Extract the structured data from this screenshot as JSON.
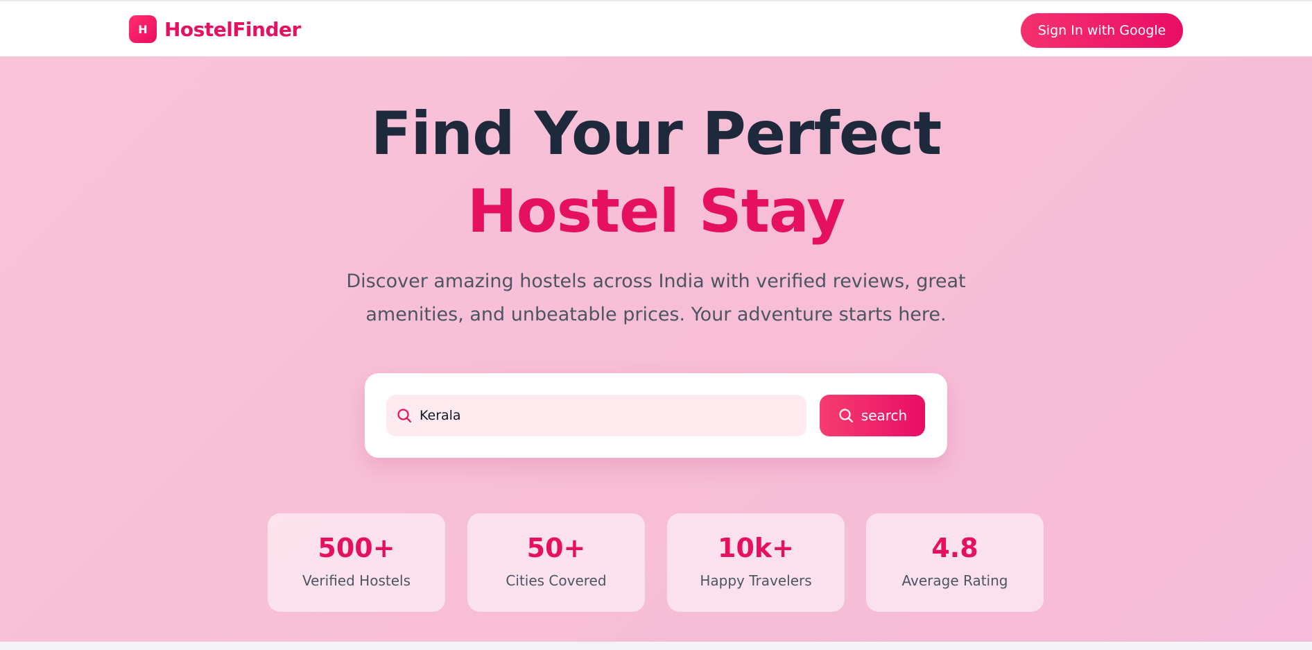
{
  "colors": {
    "accent": "#e5105f",
    "heading_dark": "#1e293b",
    "hero_background": "#f9c4d8",
    "subtitle_text": "#4b5563",
    "search_field_background": "#fdebf0"
  },
  "header": {
    "logo_letter": "H",
    "brand_name": "HostelFinder",
    "sign_in_label": "Sign In with Google"
  },
  "hero": {
    "title_line1": "Find Your Perfect",
    "title_line2": "Hostel Stay",
    "subtitle": "Discover amazing hostels across India with verified reviews, great amenities, and unbeatable prices. Your adventure starts here."
  },
  "search": {
    "icon": "search-icon",
    "value": "Kerala",
    "button_label": "search",
    "button_icon": "search-icon"
  },
  "stats": [
    {
      "value": "500+",
      "label": "Verified Hostels"
    },
    {
      "value": "50+",
      "label": "Cities Covered"
    },
    {
      "value": "10k+",
      "label": "Happy Travelers"
    },
    {
      "value": "4.8",
      "label": "Average Rating"
    }
  ]
}
